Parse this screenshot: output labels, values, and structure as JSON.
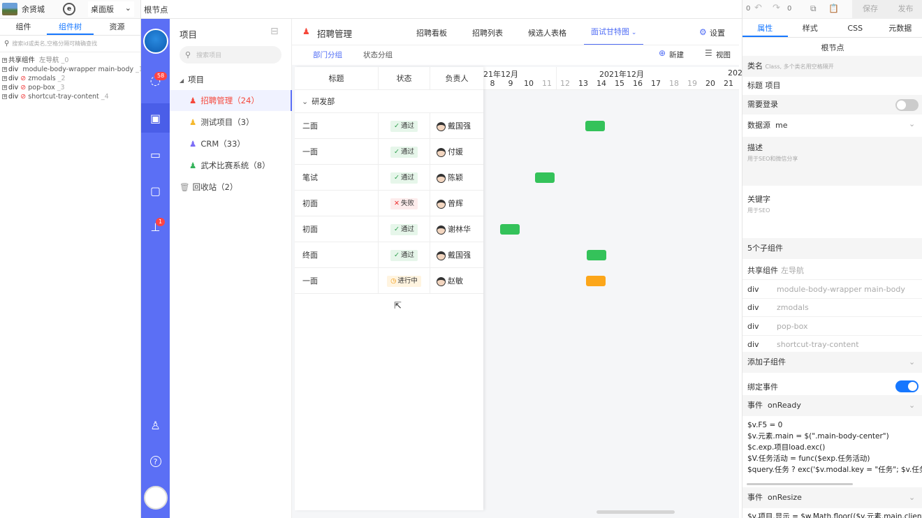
{
  "topbar": {
    "user": "余贤城",
    "mode": "桌面版",
    "node": "根节点",
    "undo_count": "0",
    "redo_count": "0",
    "save": "保存",
    "publish": "发布"
  },
  "left_panel": {
    "tabs": [
      "组件",
      "组件树",
      "资源"
    ],
    "search_placeholder": "搜索id或类名,空格分隔可精确查找",
    "tree": [
      {
        "tag": "共享组件",
        "name": "左导航",
        "idx": "_0",
        "hidden": false
      },
      {
        "tag": "div",
        "name": "module-body-wrapper main-body",
        "idx": "_1",
        "hidden": false
      },
      {
        "tag": "div",
        "name": "zmodals",
        "idx": "_2",
        "hidden": true
      },
      {
        "tag": "div",
        "name": "pop-box",
        "idx": "_3",
        "hidden": true
      },
      {
        "tag": "div",
        "name": "shortcut-tray-content",
        "idx": "_4",
        "hidden": true
      }
    ]
  },
  "nav": {
    "msg_badge": "58",
    "task_badge": "1"
  },
  "project_panel": {
    "title": "项目",
    "search_placeholder": "搜索项目",
    "group": "项目",
    "items": [
      {
        "label": "招聘管理（24）",
        "color": "#f5483b",
        "active": true
      },
      {
        "label": "测试项目（3）",
        "color": "#f5b82e",
        "active": false
      },
      {
        "label": "CRM（33）",
        "color": "#7b6cf6",
        "active": false
      },
      {
        "label": "武术比赛系统（8）",
        "color": "#34b35a",
        "active": false
      }
    ],
    "recycle": "回收站（2）"
  },
  "center": {
    "title": "招聘管理",
    "tabs": [
      "招聘看板",
      "招聘列表",
      "候选人表格",
      "面试甘特图"
    ],
    "active_tab": "面试甘特图",
    "settings": "设置",
    "subtabs": [
      "部门分组",
      "状态分组"
    ],
    "new": "新建",
    "view": "视图",
    "columns": [
      "标题",
      "状态",
      "负责人"
    ],
    "group_name": "研发部",
    "month_left": "21年12月",
    "month_center": "2021年12月",
    "month_right": "202",
    "days": [
      "8",
      "9",
      "10",
      "11",
      "12",
      "13",
      "14",
      "15",
      "16",
      "17",
      "18",
      "19",
      "20",
      "21"
    ],
    "weekend_days": [
      "11",
      "12",
      "18",
      "19"
    ],
    "rows": [
      {
        "title": "二面",
        "status": "通过",
        "status_type": "ok",
        "owner": "戴国强"
      },
      {
        "title": "一面",
        "status": "通过",
        "status_type": "ok",
        "owner": "付媛"
      },
      {
        "title": "笔试",
        "status": "通过",
        "status_type": "ok",
        "owner": "陈颖"
      },
      {
        "title": "初面",
        "status": "失败",
        "status_type": "fail",
        "owner": "曾辉"
      },
      {
        "title": "初面",
        "status": "通过",
        "status_type": "ok",
        "owner": "谢林华"
      },
      {
        "title": "终面",
        "status": "通过",
        "status_type": "ok",
        "owner": "戴国强"
      },
      {
        "title": "一面",
        "status": "进行中",
        "status_type": "run",
        "owner": "赵敏"
      }
    ],
    "bar_colors": {
      "ok": "#34c25a",
      "run": "#fca61a"
    }
  },
  "right_panel": {
    "tabs": [
      "属性",
      "样式",
      "CSS",
      "元数据"
    ],
    "node_title": "根节点",
    "class_label": "类名",
    "class_placeholder": "Class, 多个类名用空格隔开",
    "title_label": "标题",
    "title_value": "项目",
    "login_label": "需要登录",
    "datasource_label": "数据源",
    "datasource_value": "me",
    "desc_label": "描述",
    "desc_placeholder": "用于SEO和微信分享",
    "keywords_label": "关键字",
    "keywords_placeholder": "用于SEO",
    "children_label": "5个子组件",
    "children": [
      {
        "tag": "共享组件",
        "name": "左导航"
      },
      {
        "tag": "div",
        "name": "module-body-wrapper main-body"
      },
      {
        "tag": "div",
        "name": "zmodals"
      },
      {
        "tag": "div",
        "name": "pop-box"
      },
      {
        "tag": "div",
        "name": "shortcut-tray-content"
      }
    ],
    "add_child": "添加子组件",
    "bind_event": "绑定事件",
    "event_label": "事件",
    "event1": "onReady",
    "code": [
      "$v.F5 = 0",
      "$v.元素.main = $(\".main-body-center\")",
      "$c.exp.项目load.exc()",
      "$V.任务活动 = func($exp.任务活动)",
      "$query.任务 ? exc('$v.modal.key = \"任务\"; $v.任务_id"
    ],
    "event2": "onResize",
    "code2": "$v.项目.显示 = $w.Math.floor(($v.元素.main.clientW"
  }
}
